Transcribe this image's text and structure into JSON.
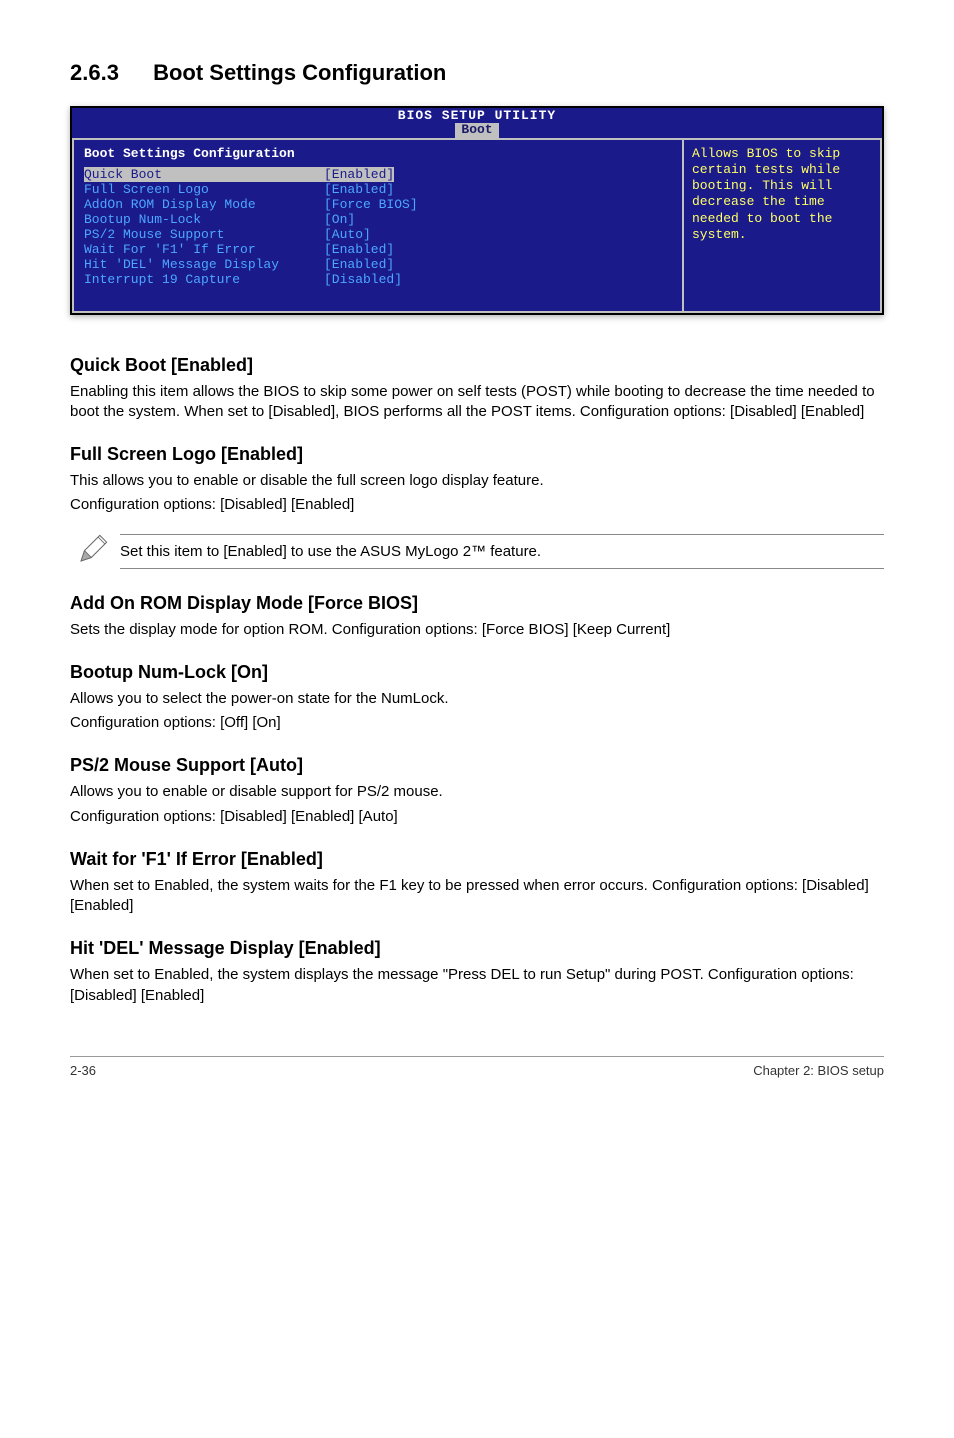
{
  "section": {
    "number": "2.6.3",
    "title": "Boot Settings Configuration"
  },
  "bios": {
    "utility_title": "BIOS SETUP UTILITY",
    "tab": "Boot",
    "panel_title": "Boot Settings Configuration",
    "rows": [
      {
        "label": "Quick Boot",
        "value": "[Enabled]",
        "highlight": true
      },
      {
        "label": "Full Screen Logo",
        "value": "[Enabled]",
        "highlight": false
      },
      {
        "label": "AddOn ROM Display Mode",
        "value": "[Force BIOS]",
        "highlight": false
      },
      {
        "label": "Bootup Num-Lock",
        "value": "[On]",
        "highlight": false
      },
      {
        "label": "PS/2 Mouse Support",
        "value": "[Auto]",
        "highlight": false
      },
      {
        "label": "Wait For 'F1' If Error",
        "value": "[Enabled]",
        "highlight": false
      },
      {
        "label": "Hit 'DEL' Message Display",
        "value": "[Enabled]",
        "highlight": false
      },
      {
        "label": "Interrupt 19 Capture",
        "value": "[Disabled]",
        "highlight": false
      }
    ],
    "help_text": "Allows BIOS to skip certain tests while booting. This will decrease the time needed to boot the system."
  },
  "content": {
    "quick_boot": {
      "heading": "Quick Boot [Enabled]",
      "body": "Enabling this item allows the BIOS to skip some power on self tests (POST) while booting to decrease the time needed to boot the system. When set to [Disabled], BIOS performs all the POST items. Configuration options: [Disabled] [Enabled]"
    },
    "full_screen_logo": {
      "heading": "Full Screen Logo [Enabled]",
      "body1": "This allows you to enable or disable the full screen logo display feature.",
      "body2": "Configuration options: [Disabled] [Enabled]"
    },
    "note": "Set this item to [Enabled] to use the ASUS MyLogo 2™ feature.",
    "addon_rom": {
      "heading": "Add On ROM Display Mode [Force BIOS]",
      "body": "Sets the display mode for option ROM. Configuration options: [Force BIOS] [Keep Current]"
    },
    "bootup_numlock": {
      "heading": "Bootup Num-Lock [On]",
      "body1": "Allows you to select the power-on state for the NumLock.",
      "body2": "Configuration options: [Off] [On]"
    },
    "ps2": {
      "heading": "PS/2 Mouse Support [Auto]",
      "body1": "Allows you to enable or disable support for PS/2 mouse.",
      "body2": "Configuration options: [Disabled] [Enabled] [Auto]"
    },
    "wait_f1": {
      "heading": "Wait for 'F1' If Error [Enabled]",
      "body": "When set to Enabled, the system waits for the F1 key to be pressed when error occurs. Configuration options: [Disabled] [Enabled]"
    },
    "hit_del": {
      "heading": "Hit 'DEL' Message Display [Enabled]",
      "body": "When set to Enabled, the system displays the message \"Press DEL to run Setup\" during POST. Configuration options: [Disabled] [Enabled]"
    }
  },
  "footer": {
    "left": "2-36",
    "right": "Chapter 2: BIOS setup"
  }
}
